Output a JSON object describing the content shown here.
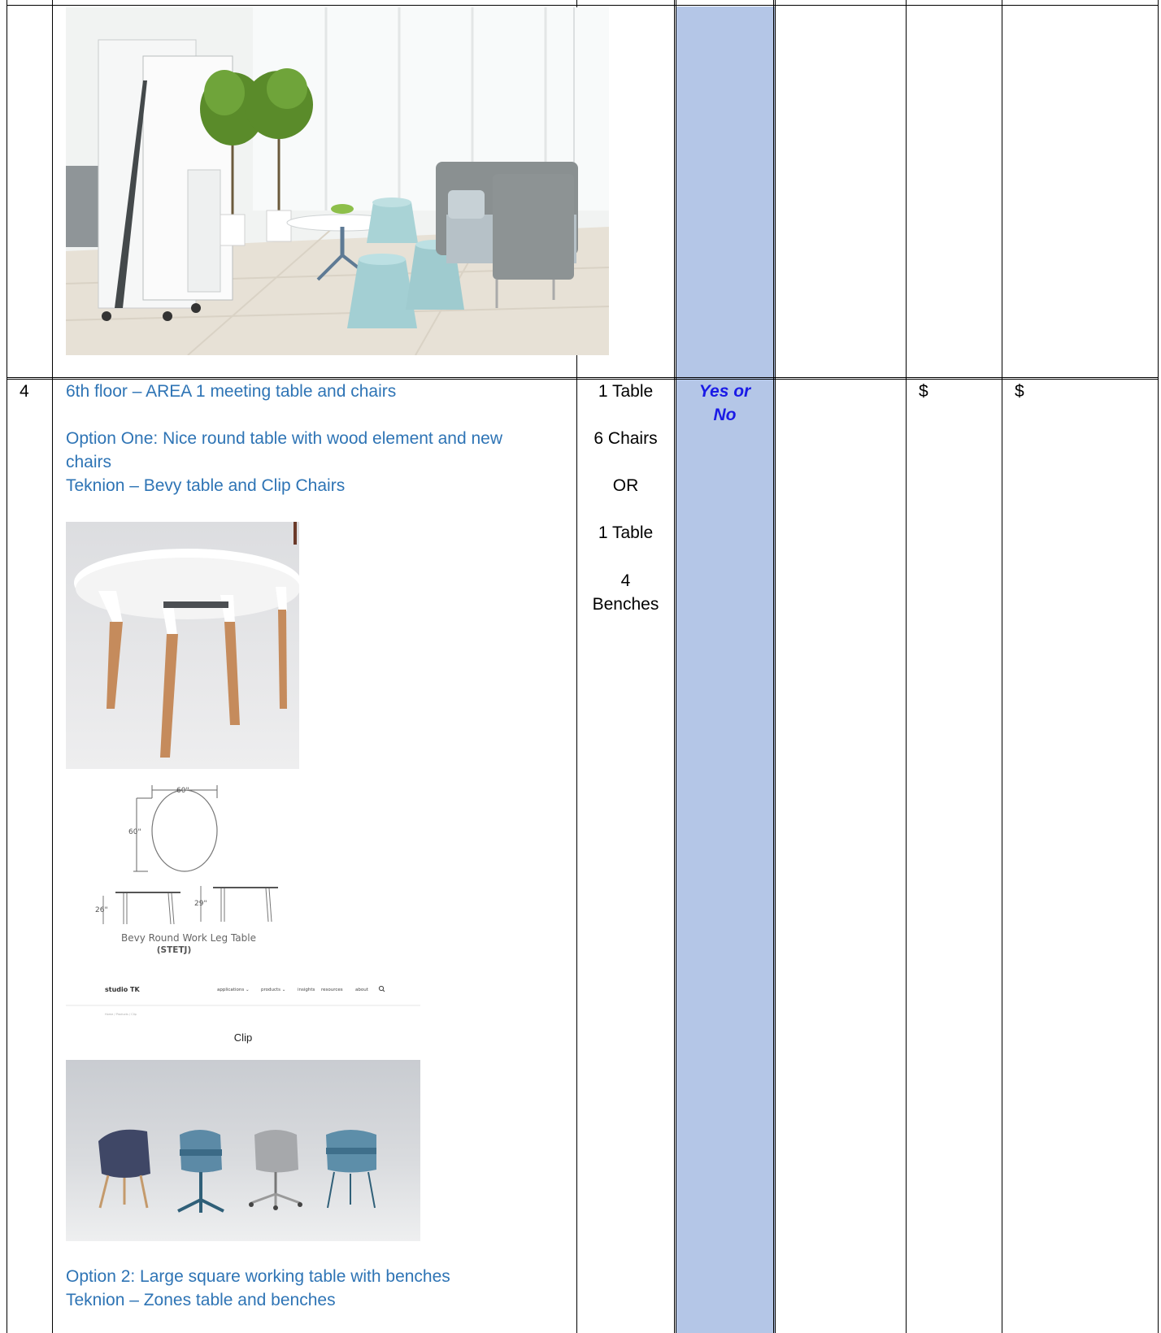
{
  "row_top": {},
  "row_4": {
    "number": "4",
    "title": "6th floor – AREA 1 meeting table and chairs",
    "option_one_line1": "Option One: Nice round table with wood element and new",
    "option_one_line2": "chairs",
    "option_one_product": "Teknion – Bevy table and Clip Chairs",
    "table_drawing": {
      "dim_width": "60\"",
      "dim_depth": "60\"",
      "height_1": "26\"",
      "height_2": "29\"",
      "caption": "Bevy Round Work Leg Table",
      "code": "(STETJ)"
    },
    "website": {
      "logo": "studio TK",
      "nav": [
        "applications ⌄",
        "products ⌄",
        "insights",
        "resources",
        "about"
      ],
      "breadcrumb": "Home / Products / Clip",
      "product_title": "Clip"
    },
    "option_two_line1": "Option 2: Large square working table with benches",
    "option_two_product": "Teknion – Zones table and benches",
    "quantities": [
      "1 Table",
      "6 Chairs",
      "OR",
      "1 Table",
      "4",
      "Benches"
    ],
    "response_line1": "Yes or",
    "response_line2": "No",
    "unit_price": "$",
    "total_price": "$"
  },
  "colors": {
    "shaded_column": "#b4c6e7",
    "description_text": "#2e74b5",
    "yes_no_text": "#1a1ae6"
  }
}
